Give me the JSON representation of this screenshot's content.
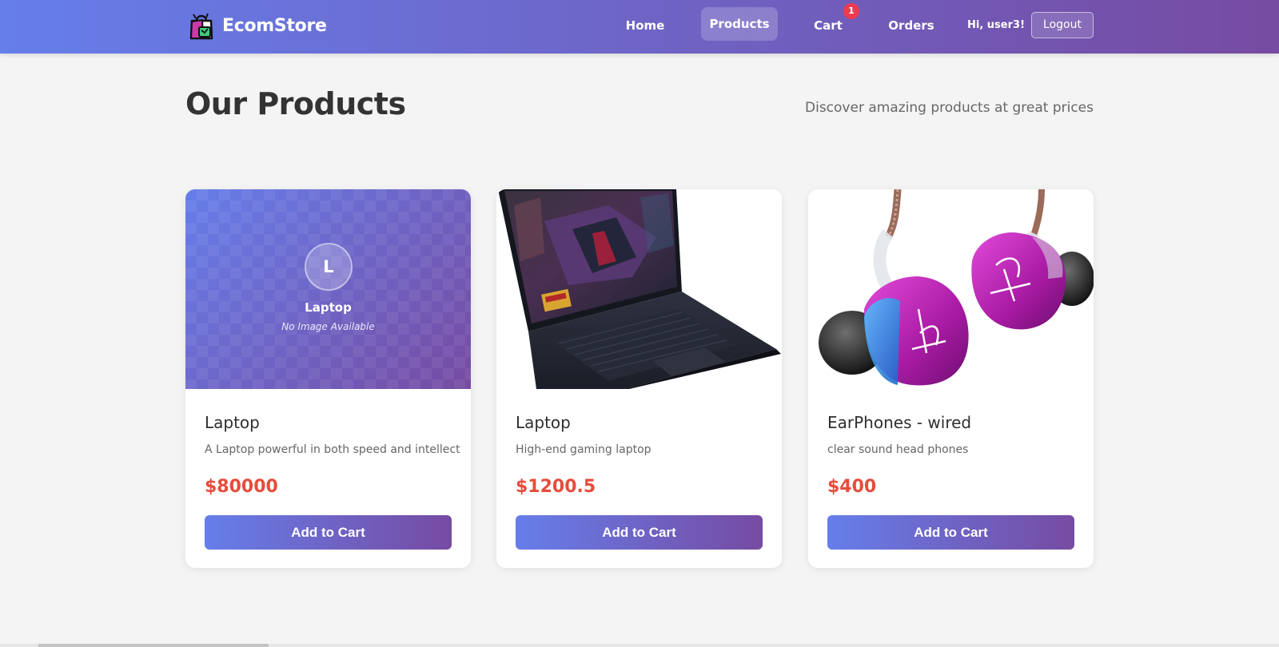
{
  "brand": {
    "name": "EcomStore",
    "icon": "shopping-bag-icon"
  },
  "nav": {
    "home": "Home",
    "products": "Products",
    "cart": "Cart",
    "cart_count": "1",
    "orders": "Orders",
    "greeting": "Hi, user3!",
    "logout": "Logout"
  },
  "page": {
    "title": "Our Products",
    "subtitle": "Discover amazing products at great prices"
  },
  "products": [
    {
      "name": "Laptop",
      "description": "A Laptop powerful in both speed and intellect",
      "price": "$80000",
      "button": "Add to Cart",
      "image": "placeholder",
      "placeholder_initial": "L",
      "placeholder_name": "Laptop",
      "placeholder_text": "No Image Available"
    },
    {
      "name": "Laptop",
      "description": "High-end gaming laptop",
      "price": "$1200.5",
      "button": "Add to Cart",
      "image": "laptop-photo"
    },
    {
      "name": "EarPhones - wired",
      "description": "clear sound head phones",
      "price": "$400",
      "button": "Add to Cart",
      "image": "earphones-photo"
    }
  ],
  "colors": {
    "header_gradient_start": "#667eea",
    "header_gradient_end": "#764ba2",
    "price": "#e74c3c",
    "badge": "#ec3b50",
    "background": "#f4f4f4"
  }
}
